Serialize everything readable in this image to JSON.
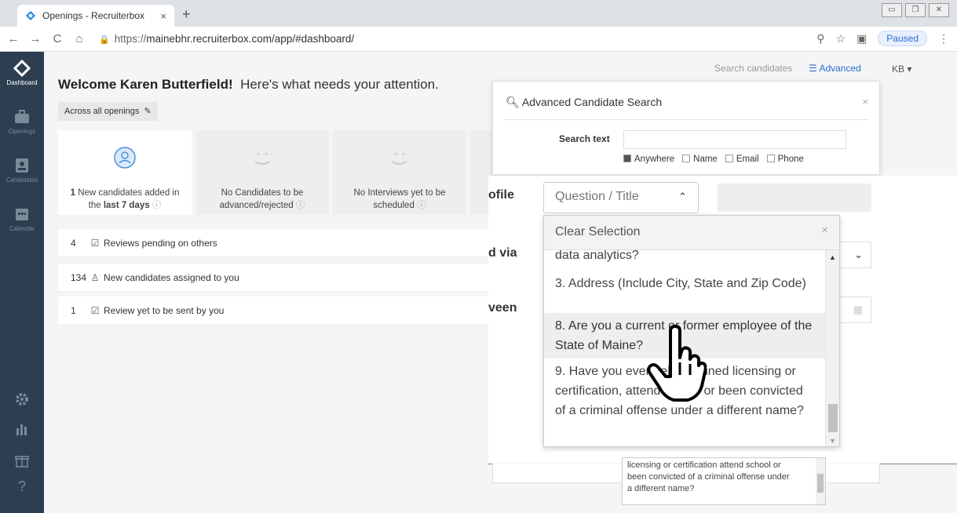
{
  "browser": {
    "tab_title": "Openings - Recruiterbox",
    "tab_close": "×",
    "new_tab": "+",
    "url_scheme": "https://",
    "url_rest": "mainebhr.recruiterbox.com/app/#dashboard/",
    "paused_label": "Paused"
  },
  "sidebar": {
    "items": [
      {
        "label": "Dashboard"
      },
      {
        "label": "Openings"
      },
      {
        "label": "Candidates"
      },
      {
        "label": "Calendar"
      }
    ],
    "help": "?"
  },
  "header": {
    "welcome_bold": "Welcome Karen Butterfield!",
    "welcome_rest": "Here's what needs your attention.",
    "across_label": "Across all openings",
    "search_placeholder": "Search candidates",
    "advanced_label": "Advanced",
    "user_initials": "KB"
  },
  "cards": [
    {
      "count": "1",
      "line1": "New candidates added in",
      "line2_pre": "the ",
      "line2_bold": "last 7 days"
    },
    {
      "count": "No",
      "line1": "Candidates to be",
      "line2": "advanced/rejected"
    },
    {
      "count": "No",
      "line1": "Interviews yet to be",
      "line2": "scheduled"
    }
  ],
  "tasks": [
    {
      "count": "4",
      "label": "Reviews pending on others"
    },
    {
      "count": "134",
      "label": "New candidates assigned to you"
    },
    {
      "count": "1",
      "label": "Review yet to be sent by you"
    }
  ],
  "modal": {
    "title": "Advanced Candidate Search",
    "close": "×",
    "search_text_label": "Search text",
    "checkboxes": [
      {
        "label": "Anywhere",
        "checked": true
      },
      {
        "label": "Name",
        "checked": false
      },
      {
        "label": "Email",
        "checked": false
      },
      {
        "label": "Phone",
        "checked": false
      }
    ]
  },
  "zoom": {
    "label_profile": "ofile",
    "label_via": "d via",
    "label_between": "veen",
    "question_title": "Question / Title",
    "clear_selection": "Clear Selection",
    "options": [
      "data analytics?",
      "3. Address (Include City, State and Zip Code)",
      "8. Are you a current or former employee of the State of Maine?",
      "9. Have you ever held, attained licensing or certification, attend school or been convicted of a criminal offense under a different name?"
    ],
    "highlighted_index": 2
  },
  "lower_dropdown": {
    "text1": "licensing or certification attend school or",
    "text2": "been convicted of a criminal offense under",
    "text3": "a different name?"
  }
}
